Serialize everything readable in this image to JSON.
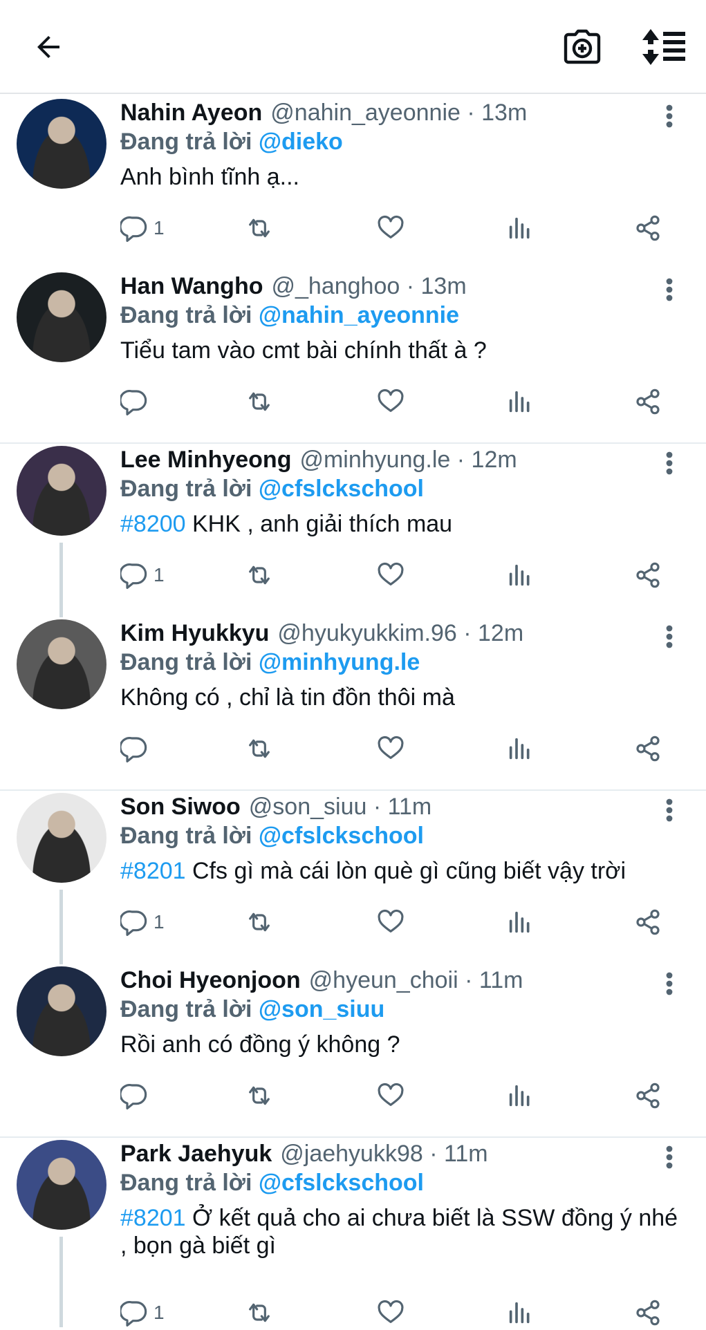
{
  "header": {
    "back_icon": "arrow-left-icon",
    "camera_icon": "camera-add-icon",
    "sort_icon": "sort-lines-icon"
  },
  "labels": {
    "replying_to": "Đang trả lời"
  },
  "colors": {
    "link": "#1d9bf0",
    "secondary": "#536471",
    "text": "#0f1419"
  },
  "tweets": [
    {
      "name": "Nahin Ayeon",
      "meta": "@nahin_ayeonnie · 13m",
      "mention": "@dieko",
      "tag": "",
      "text": "Anh bình tĩnh ạ...",
      "reply_count": "1",
      "avatar_color": "#0e2a55"
    },
    {
      "name": "Han Wangho",
      "meta": "@_hanghoo · 13m",
      "mention": "@nahin_ayeonnie",
      "tag": "",
      "text": "Tiểu tam vào cmt bài chính thất à ?",
      "reply_count": "",
      "avatar_color": "#1a1f22"
    },
    {
      "name": "Lee Minhyeong",
      "meta": "@minhyung.le · 12m",
      "mention": "@cfslckschool",
      "tag": "#8200",
      "text": " KHK , anh giải thích mau",
      "reply_count": "1",
      "avatar_color": "#3a2f4a"
    },
    {
      "name": "Kim Hyukkyu",
      "meta": "@hyukyukkim.96 · 12m",
      "mention": "@minhyung.le",
      "tag": "",
      "text": "Không có , chỉ là tin đồn thôi mà",
      "reply_count": "",
      "avatar_color": "#5a5a5a"
    },
    {
      "name": "Son Siwoo",
      "meta": "@son_siuu · 11m",
      "mention": "@cfslckschool",
      "tag": "#8201",
      "text": " Cfs gì mà cái lòn què gì cũng biết vậy trời",
      "reply_count": "1",
      "avatar_color": "#e8e8e8"
    },
    {
      "name": "Choi Hyeonjoon",
      "meta": "@hyeun_choii · 11m",
      "mention": "@son_siuu",
      "tag": "",
      "text": "Rồi anh có đồng ý không ?",
      "reply_count": "",
      "avatar_color": "#1d2a44"
    },
    {
      "name": "Park Jaehyuk",
      "meta": "@jaehyukk98 · 11m",
      "mention": "@cfslckschool",
      "tag": "#8201",
      "text": " Ở kết quả cho ai chưa biết là SSW đồng ý nhé , bọn gà biết gì",
      "reply_count": "1",
      "avatar_color": "#3b4c86"
    }
  ]
}
